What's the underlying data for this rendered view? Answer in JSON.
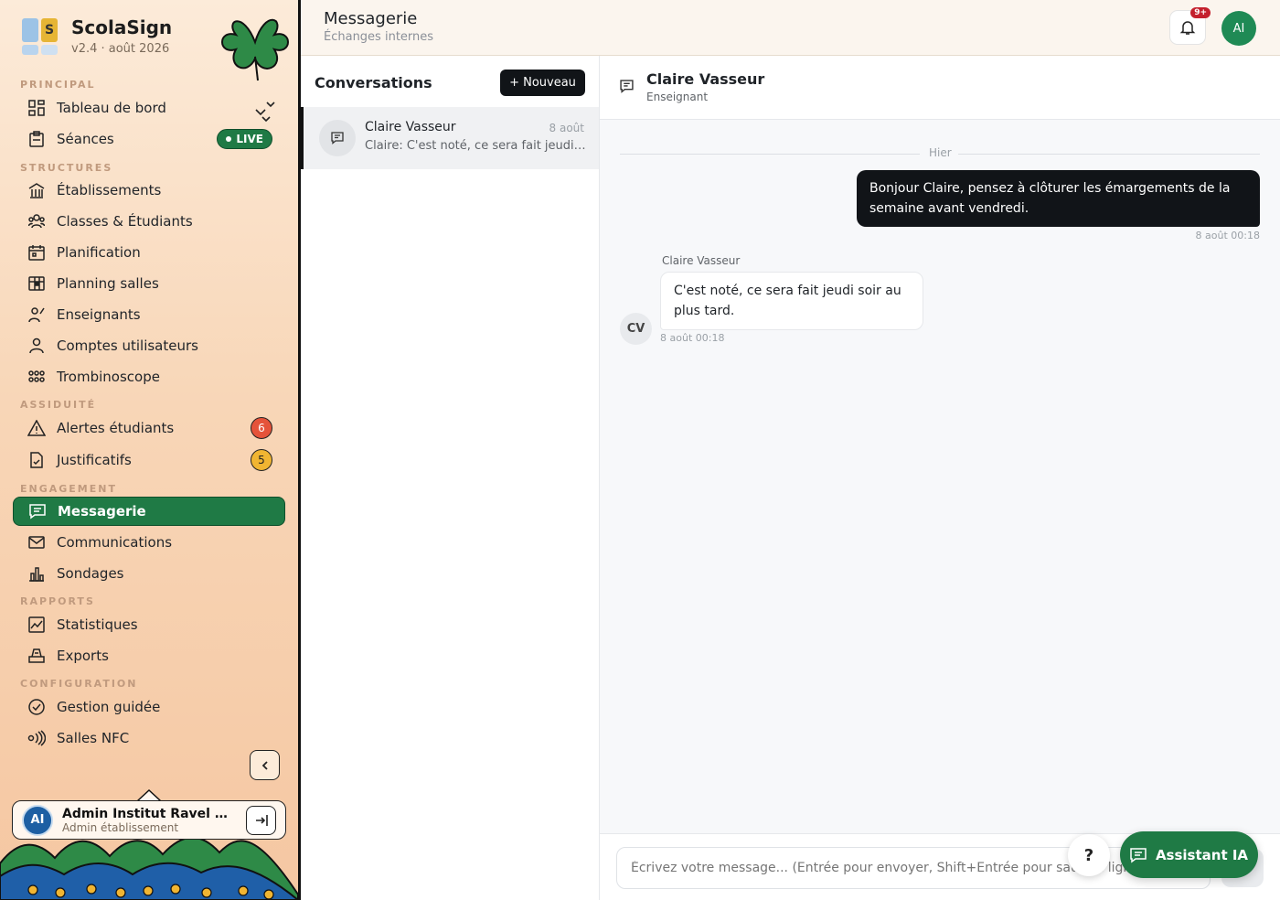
{
  "brand": {
    "name": "ScolaSign",
    "version": "v2.4 · août 2026",
    "logo_letter": "S"
  },
  "sidebar": {
    "sections": [
      {
        "title": "PRINCIPAL"
      },
      {
        "title": "STRUCTURES"
      },
      {
        "title": "ASSIDUITÉ"
      },
      {
        "title": "ENGAGEMENT"
      },
      {
        "title": "RAPPORTS"
      },
      {
        "title": "CONFIGURATION"
      }
    ],
    "items": [
      {
        "label": "Tableau de bord",
        "icon": "dashboard-icon"
      },
      {
        "label": "Séances",
        "icon": "clipboard-icon",
        "status": "LIVE"
      },
      {
        "label": "Établissements",
        "icon": "building-icon"
      },
      {
        "label": "Classes & Étudiants",
        "icon": "users-icon"
      },
      {
        "label": "Planification",
        "icon": "calendar-icon"
      },
      {
        "label": "Planning salles",
        "icon": "grid-calendar-icon"
      },
      {
        "label": "Enseignants",
        "icon": "teacher-icon"
      },
      {
        "label": "Comptes utilisateurs",
        "icon": "user-icon"
      },
      {
        "label": "Trombinoscope",
        "icon": "faces-grid-icon"
      },
      {
        "label": "Alertes étudiants",
        "icon": "warning-icon",
        "badge": "6"
      },
      {
        "label": "Justificatifs",
        "icon": "document-check-icon",
        "badge": "5"
      },
      {
        "label": "Messagerie",
        "icon": "message-icon",
        "active": true
      },
      {
        "label": "Communications",
        "icon": "mail-icon"
      },
      {
        "label": "Sondages",
        "icon": "bar-chart-icon"
      },
      {
        "label": "Statistiques",
        "icon": "line-chart-icon"
      },
      {
        "label": "Exports",
        "icon": "export-icon"
      },
      {
        "label": "Gestion guidée",
        "icon": "check-circle-icon"
      },
      {
        "label": "Salles NFC",
        "icon": "nfc-icon"
      }
    ]
  },
  "user": {
    "initials": "AI",
    "name": "Admin Institut Ravel For...",
    "role": "Admin établissement"
  },
  "header": {
    "title": "Messagerie",
    "subtitle": "Échanges internes",
    "notif_badge": "9+",
    "avatar_initials": "AI"
  },
  "conversations": {
    "title": "Conversations",
    "new_button": "+ Nouveau",
    "items": [
      {
        "name": "Claire Vasseur",
        "date": "8 août",
        "preview": "Claire: C'est noté, ce sera fait jeudi soir au plus tard."
      }
    ]
  },
  "chat": {
    "name": "Claire Vasseur",
    "role": "Enseignant",
    "day_separator": "Hier",
    "messages": [
      {
        "direction": "out",
        "text": "Bonjour Claire, pensez à clôturer les émargements de la semaine avant vendredi.",
        "time": "8 août 00:18"
      },
      {
        "direction": "in",
        "author": "Claire Vasseur",
        "initials": "CV",
        "text": "C'est noté, ce sera fait jeudi soir au plus tard.",
        "time": "8 août 00:18"
      }
    ],
    "composer_placeholder": "Écrivez votre message... (Entrée pour envoyer, Shift+Entrée pour saut de ligne)"
  },
  "floating": {
    "help_label": "?",
    "assistant_label": "Assistant IA"
  },
  "colors": {
    "accent": "#1f7a45",
    "sidebar_bg": "#f8d6b7",
    "dark": "#111418",
    "alert_red": "#e5533a",
    "alert_yellow": "#f1b532"
  }
}
